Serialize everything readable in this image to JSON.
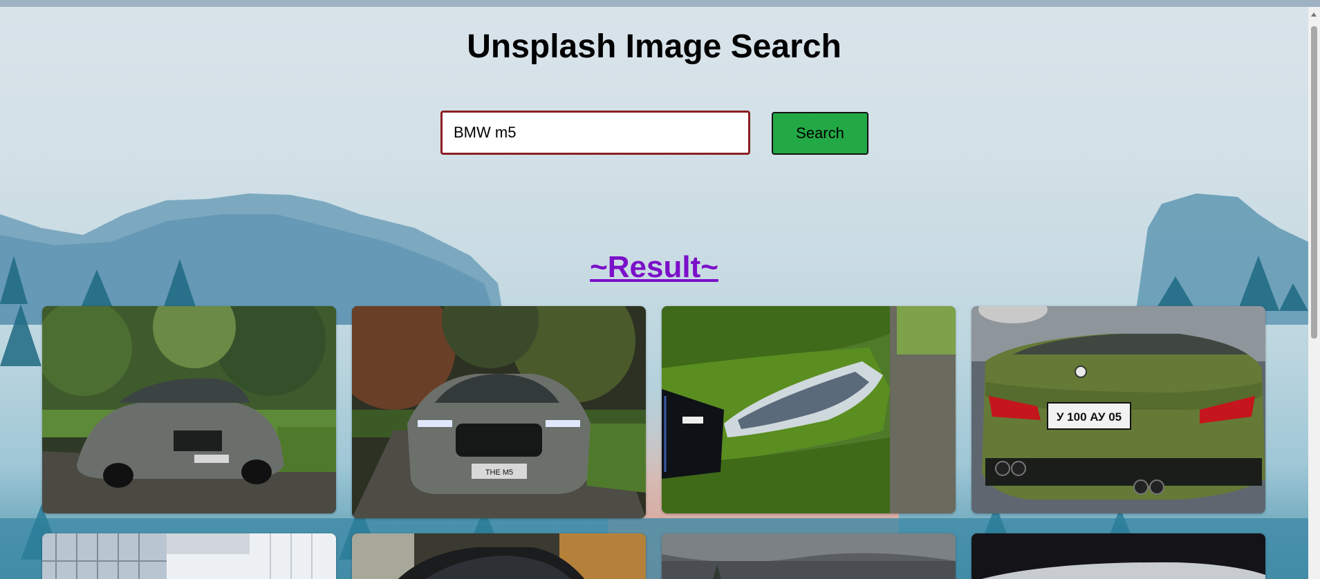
{
  "header": {
    "title": "Unsplash Image Search"
  },
  "search": {
    "value": "BMW m5",
    "button_label": "Search"
  },
  "results": {
    "heading": "~Result~",
    "images": [
      {
        "description": "grey BMW M5 front three-quarter on forest road"
      },
      {
        "description": "grey BMW M5 front view with THE M5 plate"
      },
      {
        "description": "green BMW M5 headlight close-up"
      },
      {
        "description": "green BMW M5 rear with plate y100ay05"
      },
      {
        "description": "BMW dealership building"
      },
      {
        "description": "dark BMW M5 front"
      },
      {
        "description": "BMW under cloudy sky"
      },
      {
        "description": "silver BMW on dark background"
      }
    ]
  },
  "plates": {
    "card2_plate": "THE M5",
    "card4_plate": "У 100 АУ 05"
  },
  "colors": {
    "input_border": "#8b1e22",
    "button_bg": "#22a845",
    "result_heading": "#7b10c9"
  }
}
